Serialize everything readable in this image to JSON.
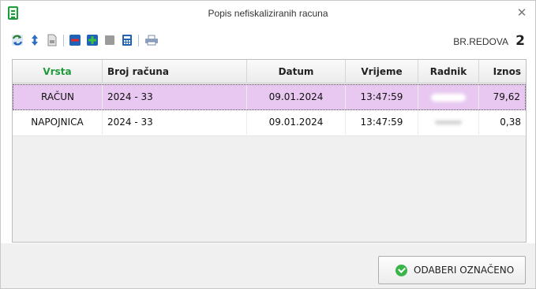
{
  "window": {
    "title": "Popis nefiskaliziranih racuna"
  },
  "toolbar": {
    "icons": [
      "refresh-icon",
      "sort-icon",
      "document-icon",
      "remove-icon",
      "add-icon",
      "stop-icon",
      "calculator-icon",
      "print-icon"
    ],
    "row_count_label": "BR.REDOVA",
    "row_count_value": "2"
  },
  "grid": {
    "headers": {
      "vrsta": "Vrsta",
      "broj_racuna": "Broj računa",
      "datum": "Datum",
      "vrijeme": "Vrijeme",
      "radnik": "Radnik",
      "iznos": "Iznos"
    },
    "header_accent_color": "#1f9a3c",
    "selected_row_color": "#e8c8f0",
    "rows": [
      {
        "vrsta": "RAČUN",
        "broj_racuna": "2024 - 33",
        "datum": "09.01.2024",
        "vrijeme": "13:47:59",
        "iznos": "79,62"
      },
      {
        "vrsta": "NAPOJNICA",
        "broj_racuna": "2024 - 33",
        "datum": "09.01.2024",
        "vrijeme": "13:47:59",
        "iznos": "0,38"
      }
    ]
  },
  "actions": {
    "select_label": "ODABERI OZNAČENO"
  }
}
